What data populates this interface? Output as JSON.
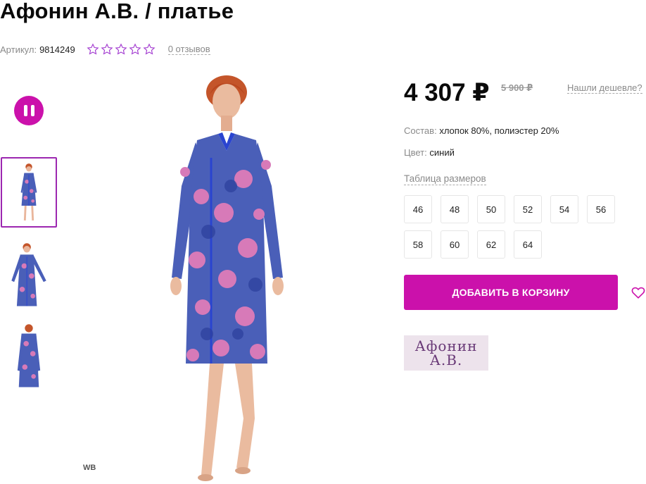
{
  "product": {
    "title": "Афонин А.В. / платье",
    "article_label": "Артикул:",
    "article_value": "9814249",
    "rating": 0,
    "max_rating": 5,
    "reviews_link": "0 отзывов"
  },
  "gallery": {
    "pause_icon": "pause-icon",
    "thumbnail_count": 3,
    "active_thumbnail": 1,
    "watermark": "WB"
  },
  "pricing": {
    "price": "4 307 ₽",
    "old_price": "5 900 ₽",
    "cheaper_link": "Нашли дешевле?"
  },
  "details": {
    "composition_label": "Состав:",
    "composition_value": "хлопок 80%, полиэстер 20%",
    "color_label": "Цвет:",
    "color_value": "синий",
    "size_table_link": "Таблица размеров"
  },
  "sizes": [
    "46",
    "48",
    "50",
    "52",
    "54",
    "56",
    "58",
    "60",
    "62",
    "64"
  ],
  "actions": {
    "add_to_cart": "ДОБАВИТЬ В КОРЗИНУ",
    "favorite_icon": "heart-icon"
  },
  "brand": {
    "logo_line1": "Афонин",
    "logo_line2": "А.В."
  },
  "colors": {
    "accent": "#cb11ab",
    "thumb_border": "#9c27b0",
    "brand_bg": "#ede3ec",
    "brand_text": "#6a3a78"
  }
}
